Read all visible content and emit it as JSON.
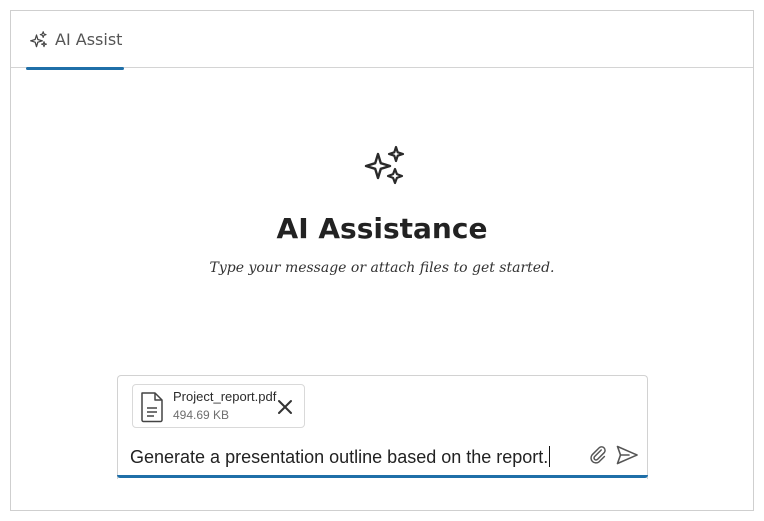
{
  "tabs": [
    {
      "label": "AI Assist",
      "icon": "sparkle-icon",
      "active": true
    }
  ],
  "hero": {
    "icon": "sparkle-icon",
    "title": "AI Assistance",
    "subtitle": "Type your message or attach files to get started."
  },
  "composer": {
    "attachment": {
      "icon": "file-icon",
      "name": "Project_report.pdf",
      "size": "494.69 KB",
      "remove_icon": "close-icon"
    },
    "input_value": "Generate a presentation outline based on the report.",
    "attach_icon": "paperclip-icon",
    "send_icon": "send-icon"
  },
  "colors": {
    "accent": "#1f6fa8",
    "border": "#cfcfcf",
    "text": "#222222",
    "muted": "#6e6e6e"
  }
}
